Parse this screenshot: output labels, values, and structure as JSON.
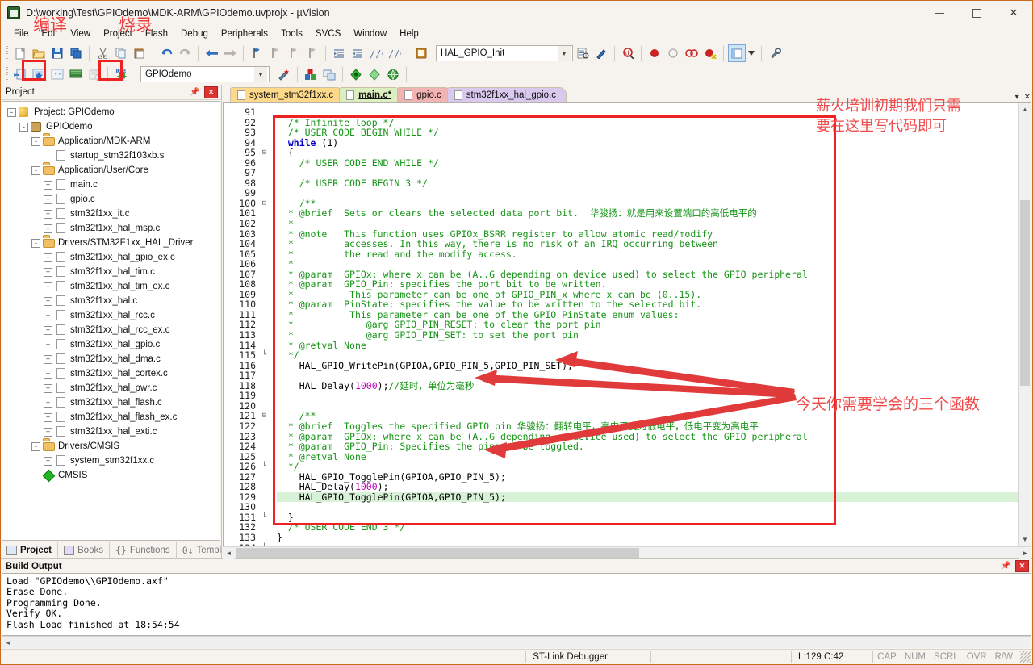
{
  "window": {
    "title": "D:\\working\\Test\\GPIOdemo\\MDK-ARM\\GPIOdemo.uvprojx - µVision",
    "app_icon": "uvision-icon",
    "minimize": "–",
    "maximize": "□",
    "close": "✕"
  },
  "menu": {
    "items": [
      {
        "label": "File"
      },
      {
        "label": "Edit"
      },
      {
        "label": "View"
      },
      {
        "label": "Project"
      },
      {
        "label": "Flash"
      },
      {
        "label": "Debug"
      },
      {
        "label": "Peripherals"
      },
      {
        "label": "Tools"
      },
      {
        "label": "SVCS"
      },
      {
        "label": "Window"
      },
      {
        "label": "Help"
      }
    ]
  },
  "annotations": {
    "compile": "编译",
    "flash": "烧录",
    "editor_note": "薪火培训初期我们只需\n要在这里写代码即可",
    "functions_note": "今天你需要学会的三个函数",
    "accent_color": "#ee2222"
  },
  "toolbar_main": {
    "buttons": [
      {
        "name": "new-file-icon",
        "glyph": "🗋"
      },
      {
        "name": "open-file-icon",
        "glyph": "📂"
      },
      {
        "name": "save-icon",
        "glyph": "💾"
      },
      {
        "name": "save-all-icon",
        "glyph": "🗐"
      },
      {
        "name": "cut-icon",
        "glyph": "✂"
      },
      {
        "name": "copy-icon",
        "glyph": "⧉"
      },
      {
        "name": "paste-icon",
        "glyph": "📋"
      },
      {
        "name": "undo-icon",
        "glyph": "↺"
      },
      {
        "name": "redo-icon",
        "glyph": "↻"
      },
      {
        "name": "navigate-back-icon",
        "glyph": "←"
      },
      {
        "name": "navigate-forward-icon",
        "glyph": "→"
      },
      {
        "name": "bookmark-toggle-icon",
        "glyph": "⚑"
      },
      {
        "name": "bookmark-prev-icon",
        "glyph": "⚐"
      },
      {
        "name": "bookmark-next-icon",
        "glyph": "⚐"
      },
      {
        "name": "bookmark-clear-icon",
        "glyph": "⚐"
      },
      {
        "name": "indent-icon",
        "glyph": "⇥"
      },
      {
        "name": "outdent-icon",
        "glyph": "⇤"
      },
      {
        "name": "comment-icon",
        "glyph": "//"
      },
      {
        "name": "uncomment-icon",
        "glyph": "//"
      },
      {
        "name": "bookmark-list-icon",
        "glyph": "📒"
      }
    ],
    "function_combo_value": "HAL_GPIO_Init",
    "after_combo": [
      {
        "name": "find-in-files-icon",
        "glyph": "🔎"
      },
      {
        "name": "insert-template-icon",
        "glyph": "✎"
      },
      {
        "name": "debug-quick-icon",
        "glyph": "Q"
      },
      {
        "name": "breakpoint-insert-icon",
        "glyph": "●"
      },
      {
        "name": "breakpoint-disable-icon",
        "glyph": "○"
      },
      {
        "name": "breakpoint-killall-icon",
        "glyph": "🚫"
      },
      {
        "name": "breakpoint-disableall-icon",
        "glyph": "◉"
      },
      {
        "name": "window-layout-icon",
        "glyph": "▤"
      },
      {
        "name": "layout-dropdown-icon",
        "glyph": "▾"
      },
      {
        "name": "configure-icon",
        "glyph": "🔧"
      }
    ]
  },
  "toolbar_build": {
    "buttons": [
      {
        "name": "translate-file-icon",
        "glyph": "🗎"
      },
      {
        "name": "build-target-icon",
        "glyph": "🏗",
        "highlighted": true
      },
      {
        "name": "rebuild-all-icon",
        "glyph": "🗗"
      },
      {
        "name": "batch-build-icon",
        "glyph": "📚"
      },
      {
        "name": "stop-build-icon",
        "glyph": "⛔"
      },
      {
        "name": "download-to-flash-icon",
        "glyph": "⬇",
        "highlighted": true
      }
    ],
    "target_combo_value": "GPIOdemo",
    "right_buttons": [
      {
        "name": "target-options-icon",
        "glyph": "🪄"
      },
      {
        "name": "manage-components-icon",
        "glyph": "🧱"
      },
      {
        "name": "manage-multiproject-icon",
        "glyph": "🗂"
      },
      {
        "name": "pack-installer-icon",
        "glyph": "◆"
      },
      {
        "name": "manage-runtime-icon",
        "glyph": "◈"
      },
      {
        "name": "pack-manage-icon",
        "glyph": "🌐"
      }
    ]
  },
  "project_panel": {
    "title": "Project",
    "pin_icon": "pin-icon",
    "close_icon": "close-icon",
    "tree": [
      {
        "label": "Project: GPIOdemo",
        "depth": 0,
        "expander": "-",
        "icon": "project-icon"
      },
      {
        "label": "GPIOdemo",
        "depth": 1,
        "expander": "-",
        "icon": "target-icon"
      },
      {
        "label": "Application/MDK-ARM",
        "depth": 2,
        "expander": "-",
        "icon": "folder-icon"
      },
      {
        "label": "startup_stm32f103xb.s",
        "depth": 3,
        "expander": "",
        "icon": "file-icon"
      },
      {
        "label": "Application/User/Core",
        "depth": 2,
        "expander": "-",
        "icon": "folder-icon"
      },
      {
        "label": "main.c",
        "depth": 3,
        "expander": "+",
        "icon": "file-icon"
      },
      {
        "label": "gpio.c",
        "depth": 3,
        "expander": "+",
        "icon": "file-icon"
      },
      {
        "label": "stm32f1xx_it.c",
        "depth": 3,
        "expander": "+",
        "icon": "file-icon"
      },
      {
        "label": "stm32f1xx_hal_msp.c",
        "depth": 3,
        "expander": "+",
        "icon": "file-icon"
      },
      {
        "label": "Drivers/STM32F1xx_HAL_Driver",
        "depth": 2,
        "expander": "-",
        "icon": "folder-icon"
      },
      {
        "label": "stm32f1xx_hal_gpio_ex.c",
        "depth": 3,
        "expander": "+",
        "icon": "file-icon"
      },
      {
        "label": "stm32f1xx_hal_tim.c",
        "depth": 3,
        "expander": "+",
        "icon": "file-icon"
      },
      {
        "label": "stm32f1xx_hal_tim_ex.c",
        "depth": 3,
        "expander": "+",
        "icon": "file-icon"
      },
      {
        "label": "stm32f1xx_hal.c",
        "depth": 3,
        "expander": "+",
        "icon": "file-icon"
      },
      {
        "label": "stm32f1xx_hal_rcc.c",
        "depth": 3,
        "expander": "+",
        "icon": "file-icon"
      },
      {
        "label": "stm32f1xx_hal_rcc_ex.c",
        "depth": 3,
        "expander": "+",
        "icon": "file-icon"
      },
      {
        "label": "stm32f1xx_hal_gpio.c",
        "depth": 3,
        "expander": "+",
        "icon": "file-icon"
      },
      {
        "label": "stm32f1xx_hal_dma.c",
        "depth": 3,
        "expander": "+",
        "icon": "file-icon"
      },
      {
        "label": "stm32f1xx_hal_cortex.c",
        "depth": 3,
        "expander": "+",
        "icon": "file-icon"
      },
      {
        "label": "stm32f1xx_hal_pwr.c",
        "depth": 3,
        "expander": "+",
        "icon": "file-icon"
      },
      {
        "label": "stm32f1xx_hal_flash.c",
        "depth": 3,
        "expander": "+",
        "icon": "file-icon"
      },
      {
        "label": "stm32f1xx_hal_flash_ex.c",
        "depth": 3,
        "expander": "+",
        "icon": "file-icon"
      },
      {
        "label": "stm32f1xx_hal_exti.c",
        "depth": 3,
        "expander": "+",
        "icon": "file-icon"
      },
      {
        "label": "Drivers/CMSIS",
        "depth": 2,
        "expander": "-",
        "icon": "folder-icon"
      },
      {
        "label": "system_stm32f1xx.c",
        "depth": 3,
        "expander": "+",
        "icon": "file-icon"
      },
      {
        "label": "CMSIS",
        "depth": 2,
        "expander": "",
        "icon": "cmsis-icon"
      }
    ],
    "tabs": [
      {
        "label": "Project",
        "active": true,
        "icon": "project-tab-icon"
      },
      {
        "label": "Books",
        "active": false,
        "icon": "books-tab-icon"
      },
      {
        "label": "Functions",
        "active": false,
        "icon": "functions-tab-icon"
      },
      {
        "label": "Templates",
        "active": false,
        "icon": "templates-tab-icon"
      }
    ]
  },
  "editor": {
    "tabs": [
      {
        "label": "system_stm32f1xx.c",
        "color": "#ffd98a",
        "active": false
      },
      {
        "label": "main.c*",
        "color": "#dbeec0",
        "active": true
      },
      {
        "label": "gpio.c",
        "color": "#f2b3b3",
        "active": false
      },
      {
        "label": "stm32f1xx_hal_gpio.c",
        "color": "#d9c9ee",
        "active": false
      }
    ],
    "first_line": 91,
    "lines": [
      {
        "n": 91,
        "fold": "",
        "html": ""
      },
      {
        "n": 92,
        "fold": "",
        "html": "  <c>/* Infinite loop */</c>"
      },
      {
        "n": 93,
        "fold": "",
        "html": "  <c>/* USER CODE BEGIN WHILE */</c>"
      },
      {
        "n": 94,
        "fold": "",
        "html": "  <k>while</k> (1)"
      },
      {
        "n": 95,
        "fold": "-",
        "html": "  {"
      },
      {
        "n": 96,
        "fold": "",
        "html": "    <c>/* USER CODE END WHILE */</c>"
      },
      {
        "n": 97,
        "fold": "",
        "html": ""
      },
      {
        "n": 98,
        "fold": "",
        "html": "    <c>/* USER CODE BEGIN 3 */</c>"
      },
      {
        "n": 99,
        "fold": "",
        "html": ""
      },
      {
        "n": 100,
        "fold": "-",
        "html": "    <c>/**</c>"
      },
      {
        "n": 101,
        "fold": "",
        "html": "  <c>* @brief  Sets or clears the selected data port bit.  </c><z>华骏扬：就是用来设置端口的高低电平的</z>"
      },
      {
        "n": 102,
        "fold": "",
        "html": "  <c>*</c>"
      },
      {
        "n": 103,
        "fold": "",
        "html": "  <c>* @note   This function uses GPIOx_BSRR register to allow atomic read/modify</c>"
      },
      {
        "n": 104,
        "fold": "",
        "html": "  <c>*         accesses. In this way, there is no risk of an IRQ occurring between</c>"
      },
      {
        "n": 105,
        "fold": "",
        "html": "  <c>*         the read and the modify access.</c>"
      },
      {
        "n": 106,
        "fold": "",
        "html": "  <c>*</c>"
      },
      {
        "n": 107,
        "fold": "",
        "html": "  <c>* @param  GPIOx: where x can be (A..G depending on device used) to select the GPIO peripheral</c>"
      },
      {
        "n": 108,
        "fold": "",
        "html": "  <c>* @param  GPIO_Pin: specifies the port bit to be written.</c>"
      },
      {
        "n": 109,
        "fold": "",
        "html": "  <c>*          This parameter can be one of GPIO_PIN_x where x can be (0..15).</c>"
      },
      {
        "n": 110,
        "fold": "",
        "html": "  <c>* @param  PinState: specifies the value to be written to the selected bit.</c>"
      },
      {
        "n": 111,
        "fold": "",
        "html": "  <c>*          This parameter can be one of the GPIO_PinState enum values:</c>"
      },
      {
        "n": 112,
        "fold": "",
        "html": "  <c>*             @arg GPIO_PIN_RESET: to clear the port pin</c>"
      },
      {
        "n": 113,
        "fold": "",
        "html": "  <c>*             @arg GPIO_PIN_SET: to set the port pin</c>"
      },
      {
        "n": 114,
        "fold": "",
        "html": "  <c>* @retval None</c>"
      },
      {
        "n": 115,
        "fold": "|",
        "html": "  <c>*/</c>"
      },
      {
        "n": 116,
        "fold": "",
        "html": "    HAL_GPIO_WritePin(GPIOA,GPIO_PIN_5,GPIO_PIN_SET);"
      },
      {
        "n": 117,
        "fold": "",
        "html": ""
      },
      {
        "n": 118,
        "fold": "",
        "html": "    HAL_Delay(<n>1000</n>);<c>//</c><z>延时，单位为毫秒</z>"
      },
      {
        "n": 119,
        "fold": "",
        "html": ""
      },
      {
        "n": 120,
        "fold": "",
        "html": ""
      },
      {
        "n": 121,
        "fold": "-",
        "html": "    <c>/**</c>"
      },
      {
        "n": 122,
        "fold": "",
        "html": "  <c>* @brief  Toggles the specified GPIO pin </c><z>华骏扬：翻转电平，高电平变为低电平，低电平变为高电平</z>"
      },
      {
        "n": 123,
        "fold": "",
        "html": "  <c>* @param  GPIOx: where x can be (A..G depending on device used) to select the GPIO peripheral</c>"
      },
      {
        "n": 124,
        "fold": "",
        "html": "  <c>* @param  GPIO_Pin: Specifies the pins to be toggled.</c>"
      },
      {
        "n": 125,
        "fold": "",
        "html": "  <c>* @retval None</c>"
      },
      {
        "n": 126,
        "fold": "|",
        "html": "  <c>*/</c>"
      },
      {
        "n": 127,
        "fold": "",
        "html": "    HAL_GPIO_TogglePin(GPIOA,GPIO_PIN_5);"
      },
      {
        "n": 128,
        "fold": "",
        "html": "    HAL_Delay(<n>1000</n>);"
      },
      {
        "n": 129,
        "fold": "",
        "html": "    HAL_GPIO_TogglePin(GPIOA,GPIO_PIN_5);",
        "highlight": true
      },
      {
        "n": 130,
        "fold": "",
        "html": ""
      },
      {
        "n": 131,
        "fold": "|",
        "html": "  }"
      },
      {
        "n": 132,
        "fold": "",
        "html": "  <c>/* USER CODE END 3 */</c>"
      },
      {
        "n": 133,
        "fold": "",
        "html": "}"
      },
      {
        "n": 134,
        "fold": "|",
        "html": ""
      }
    ]
  },
  "build_output": {
    "title": "Build Output",
    "lines": [
      "Load \"GPIOdemo\\\\GPIOdemo.axf\"",
      "Erase Done.",
      "Programming Done.",
      "Verify OK.",
      "Flash Load finished at 18:54:54"
    ]
  },
  "status_bar": {
    "debugger": "ST-Link Debugger",
    "cursor": "L:129 C:42",
    "flags": [
      "CAP",
      "NUM",
      "SCRL",
      "OVR",
      "R/W"
    ]
  }
}
